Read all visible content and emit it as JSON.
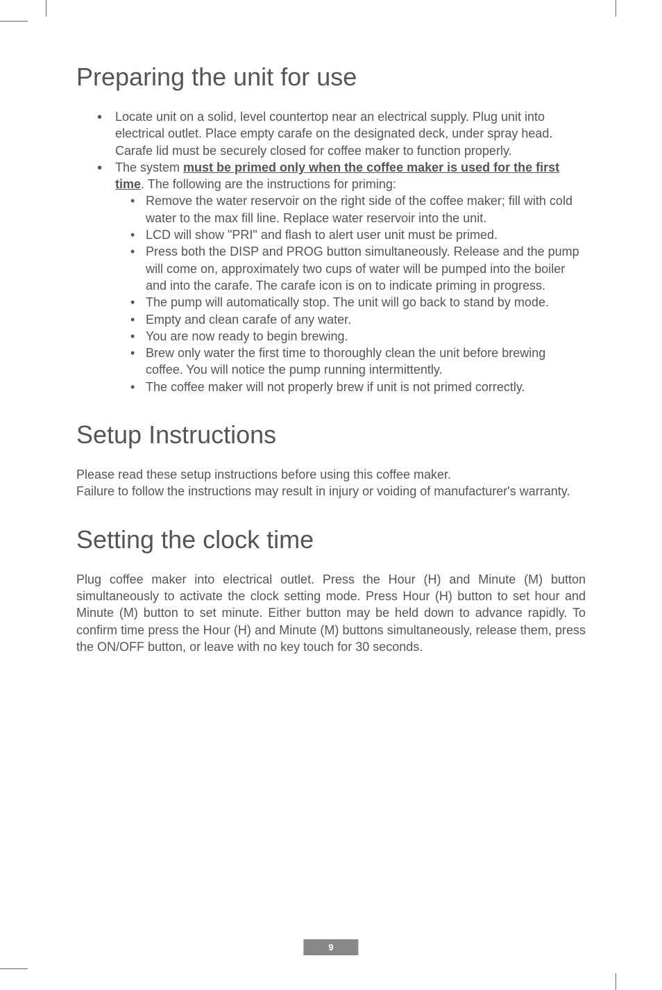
{
  "section1": {
    "heading": "Preparing the unit for use",
    "bullet1": "Locate unit on a solid, level countertop near an electrical supply. Plug unit into electrical outlet. Place empty carafe on the designated deck, under spray head. Carafe lid must be securely closed for coffee maker to function properly.",
    "bullet2_pre": "The system ",
    "bullet2_underline": "must be primed only when the coffee maker is used for the first time",
    "bullet2_post": ". The following are the instructions for priming:",
    "sub": {
      "s1": "Remove the water reservoir on the right side of the coffee maker; fill with cold water to the max fill line. Replace water reservoir into the unit.",
      "s2": "LCD will show \"PRI\" and flash to alert user unit must be primed.",
      "s3": "Press both the DISP and PROG button simultaneously.  Release and the pump will come on, approximately two cups of water will be pumped into the boiler and into the carafe. The carafe icon is on to indicate priming in progress.",
      "s4": "The pump will automatically stop. The unit will go back to stand by mode.",
      "s5": "Empty and clean carafe of any water.",
      "s6": "You are now ready to begin brewing.",
      "s7": "Brew only water the first time to thoroughly clean the unit before brewing coffee. You will notice the pump running intermittently.",
      "s8": "The coffee maker will not properly brew if unit is not primed correctly."
    }
  },
  "section2": {
    "heading": "Setup Instructions",
    "p1": "Please read these setup instructions before using this coffee maker.",
    "p2": "Failure to follow the instructions may result in injury or voiding of manufacturer's warranty."
  },
  "section3": {
    "heading": "Setting the clock time",
    "p1": "Plug coffee maker into electrical outlet. Press the Hour (H) and Minute (M) button simultaneously to activate the clock setting mode. Press Hour (H) button to set hour and Minute (M) button to set minute. Either button may be held down to advance rapidly. To confirm time press the Hour (H) and Minute (M) buttons simultaneously, release them, press the ON/OFF button, or leave with no key touch for 30 seconds."
  },
  "page_number": "9"
}
